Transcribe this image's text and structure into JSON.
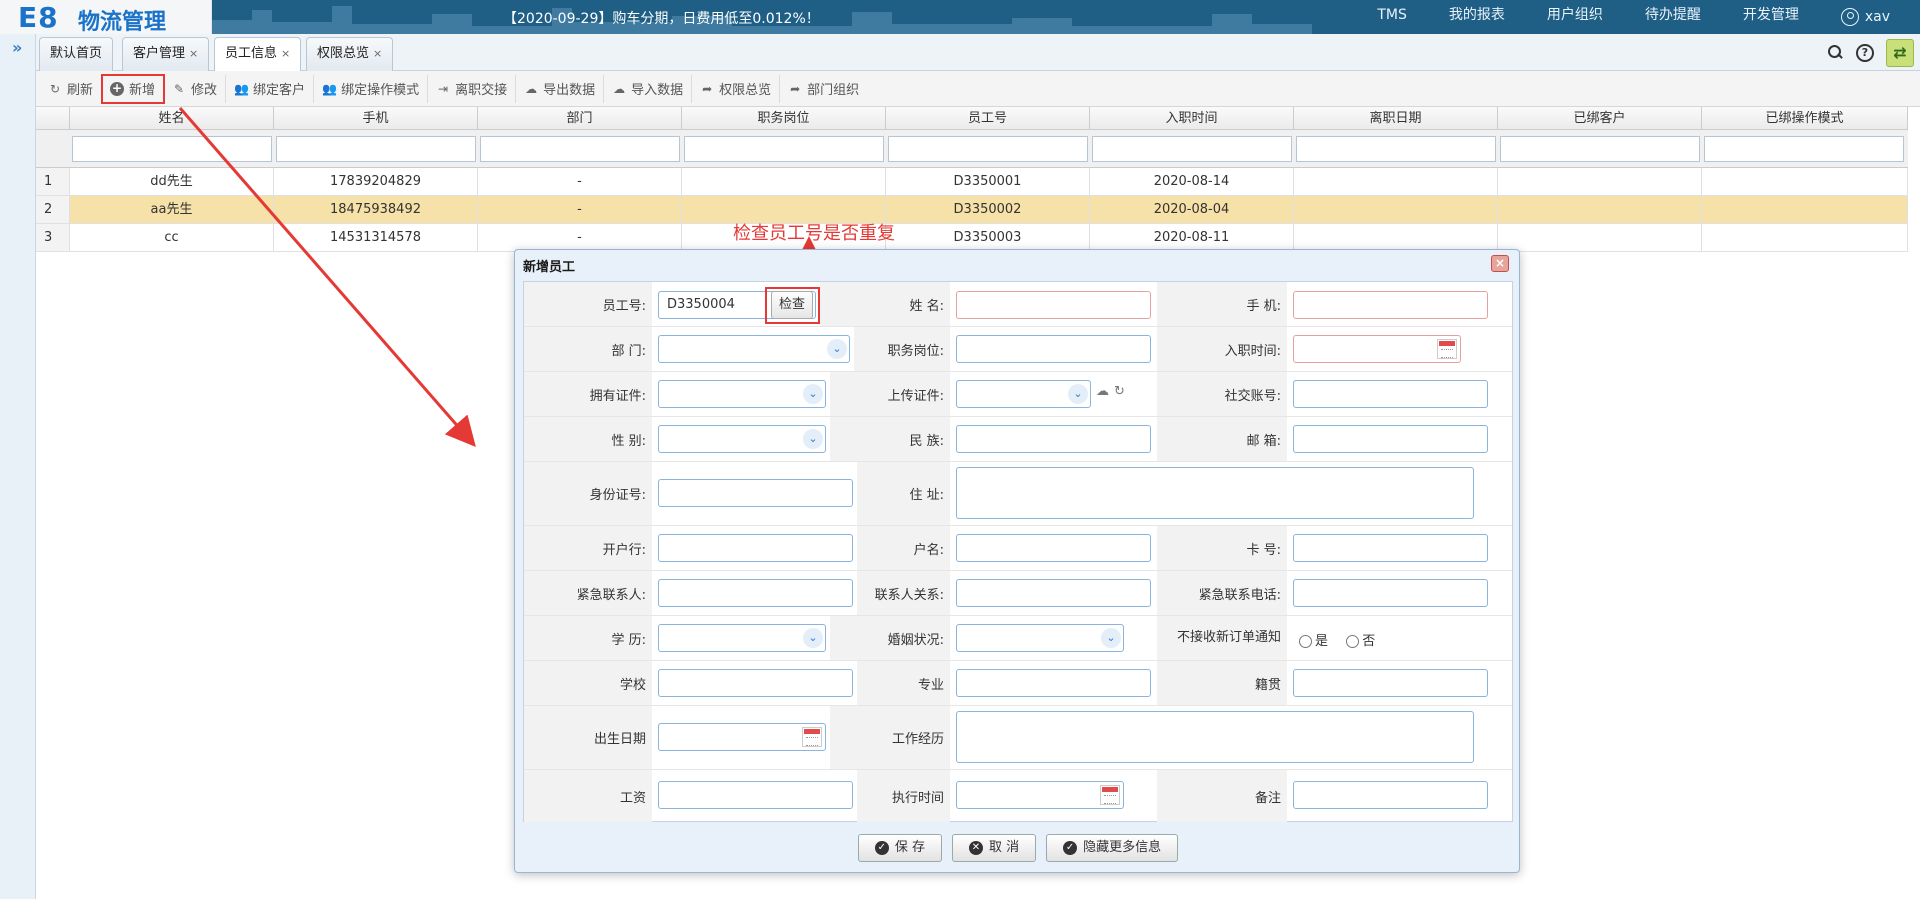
{
  "app": {
    "logo_mark": "E8",
    "logo_text": "物流管理",
    "notice": "【2020-09-29】购车分期，日费用低至0.012%！",
    "menu": [
      "TMS",
      "我的报表",
      "用户组织",
      "待办提醒",
      "开发管理"
    ],
    "user": "xav"
  },
  "tabs": [
    {
      "label": "默认首页"
    },
    {
      "label": "客户管理",
      "close": "×"
    },
    {
      "label": "员工信息",
      "close": "×"
    },
    {
      "label": "权限总览",
      "close": "×"
    }
  ],
  "toolbar": [
    "刷新",
    "新增",
    "修改",
    "绑定客户",
    "绑定操作模式",
    "离职交接",
    "导出数据",
    "导入数据",
    "权限总览",
    "部门组织"
  ],
  "grid": {
    "columns": [
      "姓名",
      "手机",
      "部门",
      "职务岗位",
      "员工号",
      "入职时间",
      "离职日期",
      "已绑客户",
      "已绑操作模式"
    ],
    "rows": [
      {
        "num": "1",
        "cells": [
          "dd先生",
          "17839204829",
          "-",
          "",
          "D3350001",
          "2020-08-14",
          "",
          "",
          ""
        ]
      },
      {
        "num": "2",
        "cells": [
          "aa先生",
          "18475938492",
          "-",
          "",
          "D3350002",
          "2020-08-04",
          "",
          "",
          ""
        ]
      },
      {
        "num": "3",
        "cells": [
          "cc",
          "14531314578",
          "-",
          "",
          "D3350003",
          "2020-08-11",
          "",
          "",
          ""
        ]
      }
    ]
  },
  "annotation": "检查员工号是否重复",
  "dialog": {
    "title": "新增员工",
    "close": "×",
    "employee_no": "D3350004",
    "check_label": "检查",
    "labels": {
      "r1": [
        "员工号:",
        "姓 名:",
        "手 机:"
      ],
      "r2": [
        "部 门:",
        "职务岗位:",
        "入职时间:"
      ],
      "r3": [
        "拥有证件:",
        "上传证件:",
        "社交账号:"
      ],
      "r4": [
        "性 别:",
        "民 族:",
        "邮 箱:"
      ],
      "r5": [
        "身份证号:",
        "住 址:"
      ],
      "r6": [
        "开户行:",
        "户名:",
        "卡 号:"
      ],
      "r7": [
        "紧急联系人:",
        "联系人关系:",
        "紧急联系电话:"
      ],
      "r8": [
        "学 历:",
        "婚姻状况:",
        "不接收新订单通知"
      ],
      "r9": [
        "学校",
        "专业",
        "籍贯"
      ],
      "r10": [
        "出生日期",
        "工作经历"
      ],
      "r11": [
        "工资",
        "执行时间",
        "备注"
      ]
    },
    "radio_yes": "是",
    "radio_no": "否",
    "buttons": [
      "保 存",
      "取 消",
      "隐藏更多信息"
    ]
  }
}
